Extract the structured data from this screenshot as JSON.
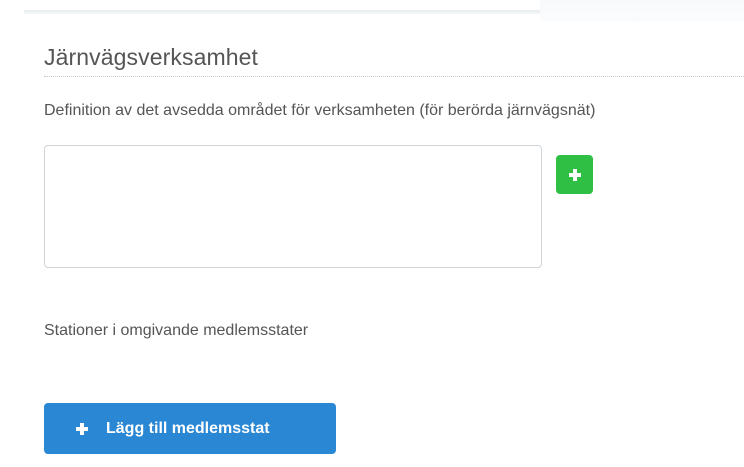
{
  "section": {
    "title": "Järnvägsverksamhet"
  },
  "definition": {
    "label": "Definition av det avsedda området för verksamheten (för berörda järnvägsnät)",
    "value": "",
    "add_icon": "plus-icon",
    "add_button_color": "#2fbf45"
  },
  "stations": {
    "label": "Stationer i omgivande medlemsstater"
  },
  "add_member_state": {
    "label": "Lägg till medlemsstat",
    "icon": "plus-icon",
    "color": "#2a87d4"
  }
}
